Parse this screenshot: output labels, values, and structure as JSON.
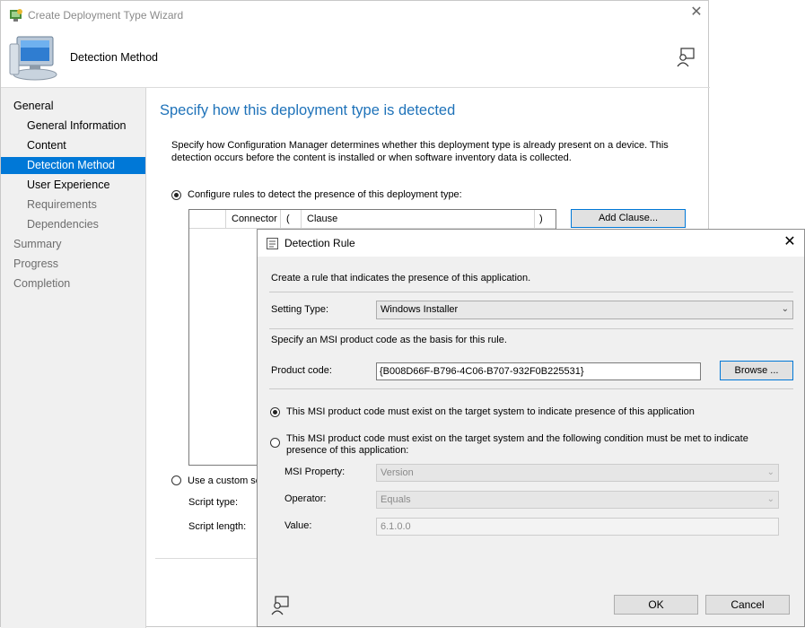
{
  "wizard": {
    "title": "Create Deployment Type Wizard",
    "header_title": "Detection Method",
    "nav": [
      {
        "label": "General",
        "level": "top",
        "state": "normal"
      },
      {
        "label": "General Information",
        "level": "sub",
        "state": "normal"
      },
      {
        "label": "Content",
        "level": "sub",
        "state": "normal"
      },
      {
        "label": "Detection Method",
        "level": "sub",
        "state": "selected"
      },
      {
        "label": "User Experience",
        "level": "sub",
        "state": "normal"
      },
      {
        "label": "Requirements",
        "level": "sub",
        "state": "dim"
      },
      {
        "label": "Dependencies",
        "level": "sub",
        "state": "dim"
      },
      {
        "label": "Summary",
        "level": "top",
        "state": "dim"
      },
      {
        "label": "Progress",
        "level": "top",
        "state": "dim"
      },
      {
        "label": "Completion",
        "level": "top",
        "state": "dim"
      }
    ],
    "heading": "Specify how this deployment type is detected",
    "description": "Specify how Configuration Manager determines whether this deployment type is already present on a device. This detection occurs before the content is installed or when software inventory data is collected.",
    "radio_rules_label": "Configure rules to detect the presence of this deployment type:",
    "table_columns": [
      "Connector",
      "(",
      "Clause",
      ")"
    ],
    "add_clause_label": "Add Clause...",
    "radio_script_label": "Use a custom sc",
    "script_type_label": "Script type:",
    "script_length_label": "Script length:"
  },
  "dialog": {
    "title": "Detection Rule",
    "intro": "Create a rule that indicates the presence of this application.",
    "setting_type_label": "Setting Type:",
    "setting_type_value": "Windows Installer",
    "msi_text": "Specify an MSI product code as the basis for this rule.",
    "product_code_label": "Product code:",
    "product_code_value": "{B008D66F-B796-4C06-B707-932F0B225531}",
    "browse_label": "Browse ...",
    "option1_label": "This MSI product code must exist on the target system to indicate presence of this application",
    "option2_label": "This MSI product code must exist on the target system and the following condition must be met to indicate presence of this application:",
    "msi_property_label": "MSI Property:",
    "msi_property_value": "Version",
    "operator_label": "Operator:",
    "operator_value": "Equals",
    "value_label": "Value:",
    "value_value": "6.1.0.0",
    "ok_label": "OK",
    "cancel_label": "Cancel"
  },
  "colors": {
    "accent": "#0078d7",
    "heading": "#1e72b9",
    "nav_bg": "#f0f0f0",
    "dialog_bg": "#f0f0f0"
  }
}
